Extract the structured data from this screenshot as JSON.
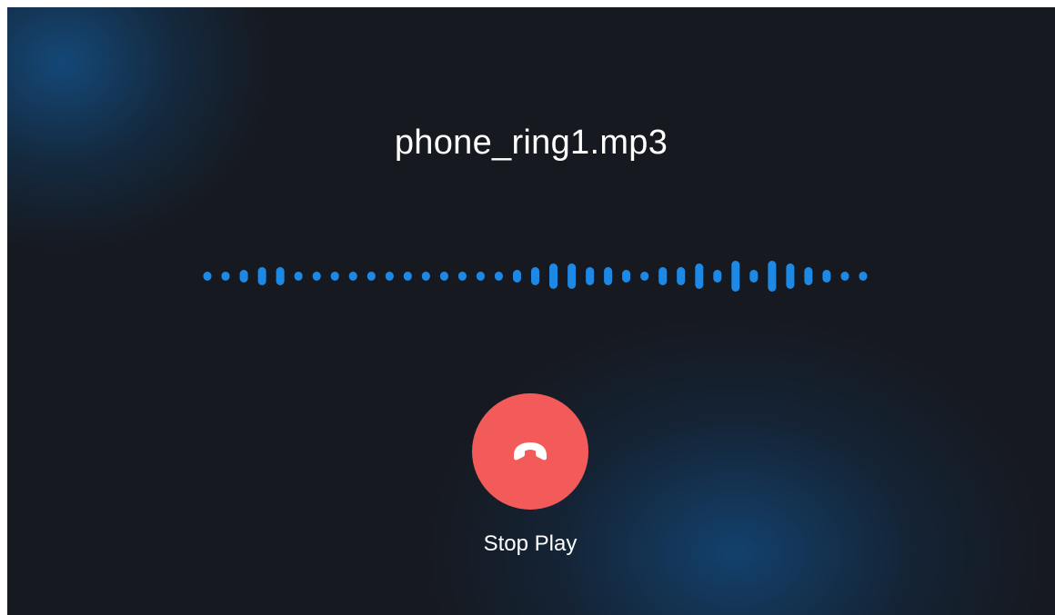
{
  "player": {
    "file_name": "phone_ring1.mp3",
    "stop_label": "Stop Play",
    "stop_icon": "phone-hangup-icon"
  },
  "waveform": {
    "color": "#1e88e5",
    "bar_levels": [
      1,
      1,
      2,
      3,
      3,
      1,
      1,
      1,
      1,
      1,
      1,
      1,
      1,
      1,
      1,
      1,
      1,
      2,
      3,
      4,
      4,
      3,
      3,
      2,
      1,
      3,
      3,
      4,
      2,
      5,
      2,
      5,
      4,
      3,
      2,
      1,
      1
    ]
  },
  "theme": {
    "background": "#16191f",
    "glow": "#14508a",
    "stop_button": "#f25b59",
    "text": "#ffffff"
  }
}
